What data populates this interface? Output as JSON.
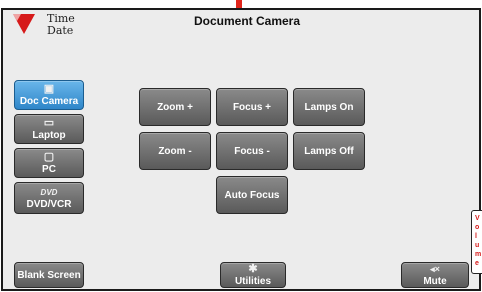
{
  "header": {
    "time_label": "Time",
    "date_label": "Date",
    "title": "Document Camera"
  },
  "sources": [
    {
      "label": "Doc Camera",
      "icon": "document-camera-icon",
      "active": true
    },
    {
      "label": "Laptop",
      "icon": "laptop-icon",
      "active": false
    },
    {
      "label": "PC",
      "icon": "monitor-icon",
      "active": false
    },
    {
      "label": "DVD/VCR",
      "icon": "dvd-icon",
      "active": false
    }
  ],
  "camera_controls": {
    "zoom_in": "Zoom +",
    "zoom_out": "Zoom -",
    "focus_in": "Focus +",
    "focus_out": "Focus -",
    "auto_focus": "Auto Focus",
    "lamps_on": "Lamps On",
    "lamps_off": "Lamps Off"
  },
  "footer": {
    "blank_screen": "Blank Screen",
    "utilities": "Utilities",
    "utilities_icon": "gear-icon",
    "mute": "Mute",
    "mute_icon": "speaker-mute-icon"
  },
  "side_tab": {
    "letters": [
      "V",
      "o",
      "l",
      "u",
      "m",
      "e"
    ]
  },
  "colors": {
    "accent_red": "#e1251b",
    "active_blue": "#3b95d6",
    "button_gray": "#6e6e6e",
    "panel_bg": "#ececec"
  }
}
